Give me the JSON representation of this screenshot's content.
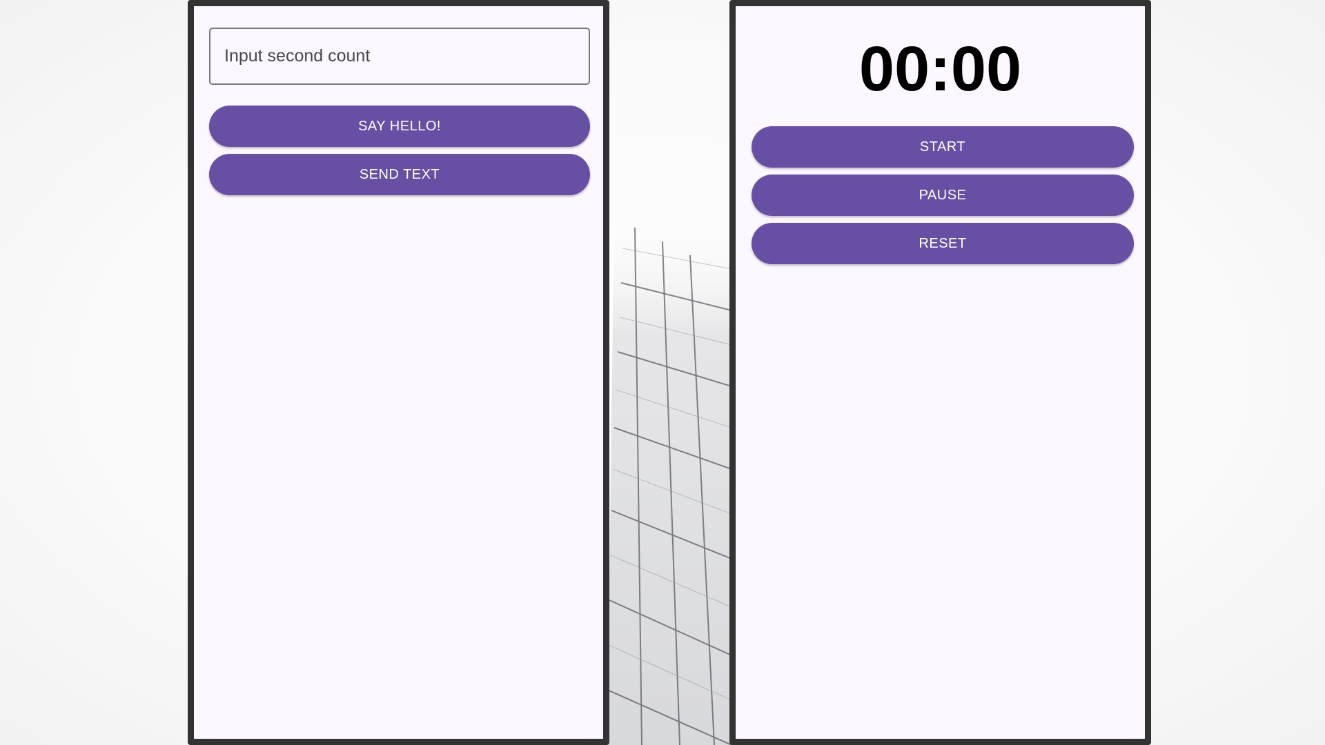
{
  "left_screen": {
    "input": {
      "value": "",
      "placeholder": "Input second count"
    },
    "say_hello_label": "SAY HELLO!",
    "send_text_label": "SEND TEXT"
  },
  "right_screen": {
    "timer_display": "00:00",
    "start_label": "START",
    "pause_label": "PAUSE",
    "reset_label": "RESET"
  },
  "colors": {
    "accent": "#6750a4",
    "screen_background": "#fdf7ff",
    "frame": "#333333"
  }
}
